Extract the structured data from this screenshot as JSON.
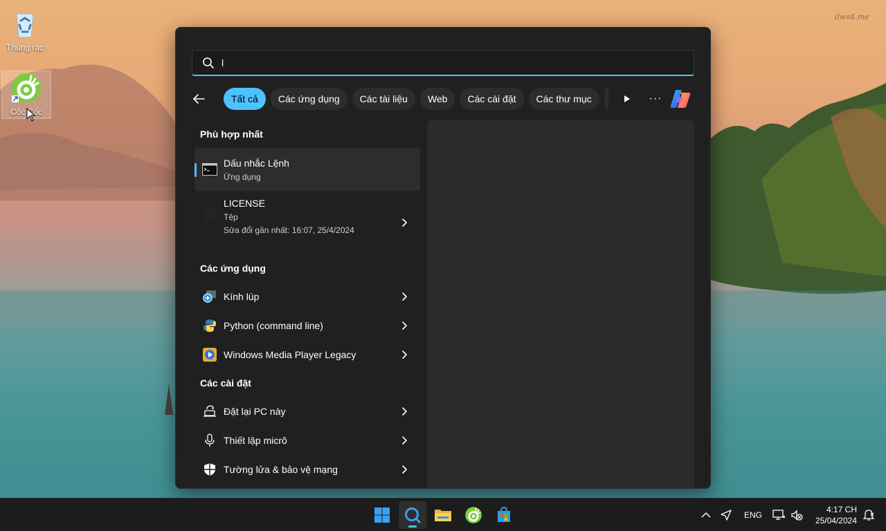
{
  "desktop": {
    "watermark": "dws4.me",
    "icons": [
      {
        "label": "Thùng rác",
        "icon": "recycle-bin-icon"
      },
      {
        "label": "Cốc Cốc",
        "icon": "coccoc-browser-icon"
      }
    ]
  },
  "search": {
    "query": "l",
    "placeholder": ""
  },
  "filters": {
    "chips": [
      "Tất cả",
      "Các ứng dụng",
      "Các tài liệu",
      "Web",
      "Các cài đặt",
      "Các thư mục"
    ],
    "active_index": 0,
    "more_label": "···"
  },
  "results": {
    "best_match": {
      "heading": "Phù hợp nhất",
      "title": "Dấu nhắc Lệnh",
      "subtitle": "Ứng dụng",
      "icon": "command-prompt-icon"
    },
    "file": {
      "title": "LICENSE",
      "type": "Tệp",
      "modified": "Sửa đổi gần nhất: 16:07, 25/4/2024",
      "icon": "file-icon"
    },
    "apps": {
      "heading": "Các ứng dụng",
      "items": [
        {
          "label": "Kính lúp",
          "icon": "magnifier-icon"
        },
        {
          "label": "Python (command line)",
          "icon": "python-icon"
        },
        {
          "label": "Windows Media Player Legacy",
          "icon": "media-player-icon"
        }
      ]
    },
    "settings": {
      "heading": "Các cài đặt",
      "items": [
        {
          "label": "Đặt lại PC này",
          "icon": "reset-pc-icon"
        },
        {
          "label": "Thiết lập micrô",
          "icon": "microphone-icon"
        },
        {
          "label": "Tường lửa & bảo vệ mạng",
          "icon": "shield-icon"
        }
      ]
    }
  },
  "taskbar": {
    "apps": [
      "start-icon",
      "search-icon",
      "file-explorer-icon",
      "coccoc-browser-icon",
      "microsoft-store-icon"
    ],
    "language": "ENG",
    "time": "4:17 CH",
    "date": "25/04/2024"
  },
  "colors": {
    "accent": "#4cc2ff",
    "panel_bg": "#202020",
    "chip_bg": "#2d2d2d",
    "taskbar_bg": "#1c1c1c"
  }
}
